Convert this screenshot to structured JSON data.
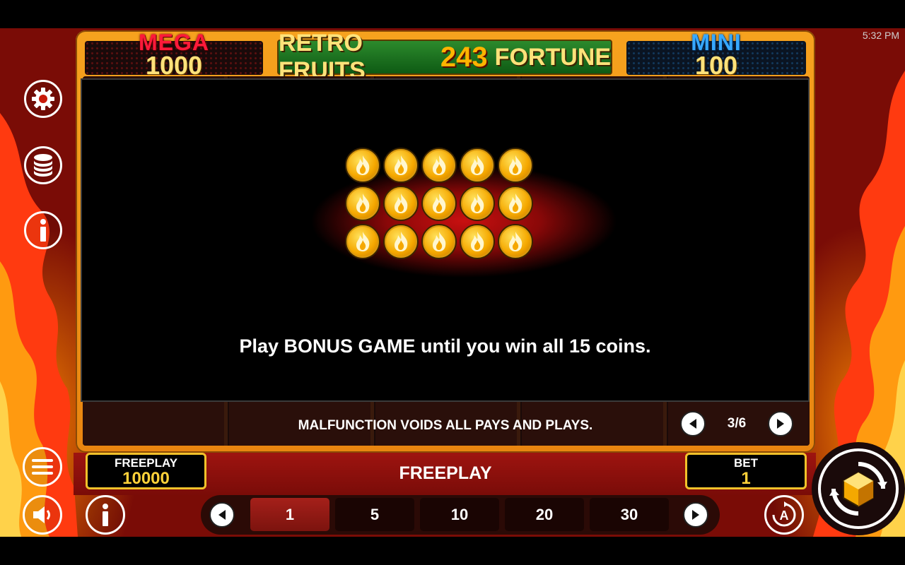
{
  "status": {
    "time": "5:32 PM"
  },
  "jackpots": {
    "mega": {
      "label": "MEGA",
      "value": "1000"
    },
    "mini": {
      "label": "MINI",
      "value": "100"
    }
  },
  "title": {
    "part1": "RETRO FRUITS",
    "part2": "243",
    "part3": "FORTUNE"
  },
  "info_panel": {
    "coin_count": 15,
    "text": "Play BONUS GAME until you win all 15 coins."
  },
  "footer": {
    "malfunction": "MALFUNCTION VOIDS ALL PAYS AND PLAYS.",
    "page": "3/6"
  },
  "balance": {
    "label": "FREEPLAY",
    "value": "10000"
  },
  "center_label": "FREEPLAY",
  "bet": {
    "label": "BET",
    "value": "1"
  },
  "bet_options": [
    "1",
    "5",
    "10",
    "20",
    "30"
  ],
  "selected_bet": "1",
  "icons": {
    "settings": "gear-icon",
    "coins": "coin-stack-icon",
    "info": "info-icon",
    "menu": "menu-icon",
    "sound": "speaker-icon",
    "autoplay": "autoplay-icon",
    "spin": "spin-icon"
  },
  "colors": {
    "frame": "#f6a21e",
    "accent": "#ffd23a",
    "background": "#c81a0a"
  }
}
